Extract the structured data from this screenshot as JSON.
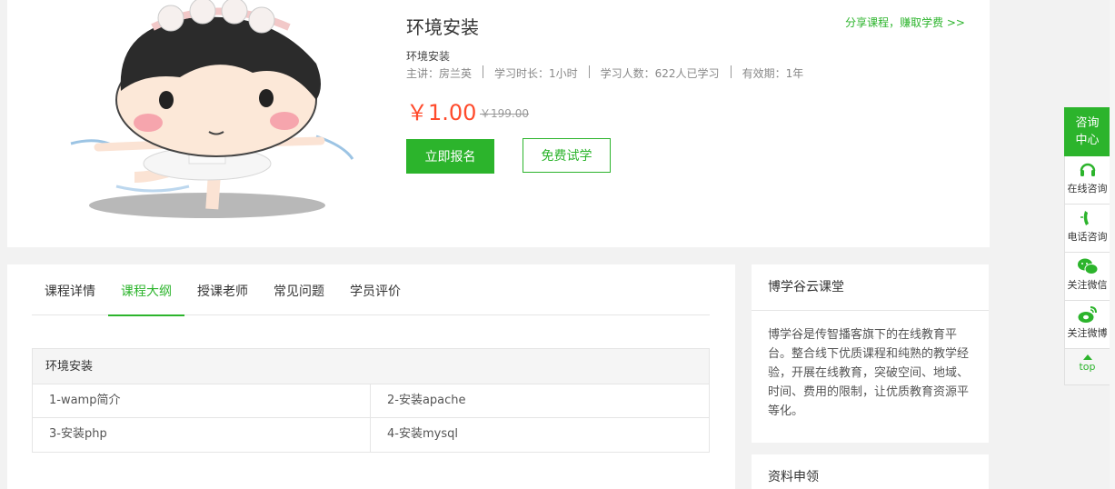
{
  "course": {
    "title": "环境安装",
    "share_link": "分享课程，赚取学费 >>",
    "subtitle": "环境安装",
    "meta": [
      "主讲：房兰英",
      "学习时长：1小时",
      "学习人数：622人已学习",
      "有效期：1年"
    ],
    "price": "￥1.00",
    "original_price": "￥199.00",
    "enroll_button": "立即报名",
    "trial_button": "免费试学"
  },
  "tabs": [
    {
      "label": "课程详情",
      "active": false
    },
    {
      "label": "课程大纲",
      "active": true
    },
    {
      "label": "授课老师",
      "active": false
    },
    {
      "label": "常见问题",
      "active": false
    },
    {
      "label": "学员评价",
      "active": false
    }
  ],
  "outline": {
    "section_title": "环境安装",
    "lessons": [
      "1-wamp简介",
      "2-安装apache",
      "3-安装php",
      "4-安装mysql"
    ]
  },
  "sidebar": {
    "about_title": "博学谷云课堂",
    "about_text": "博学谷是传智播客旗下的在线教育平台。整合线下优质课程和纯熟的教学经验，开展在线教育，突破空间、地域、时间、费用的限制，让优质教育资源平等化。",
    "materials_title": "资料申领"
  },
  "float_bar": {
    "header": "咨询中心",
    "items": [
      {
        "label": "在线咨询",
        "icon": "headset-icon"
      },
      {
        "label": "电话咨询",
        "icon": "phone-icon"
      },
      {
        "label": "关注微信",
        "icon": "wechat-icon"
      },
      {
        "label": "关注微博",
        "icon": "weibo-icon"
      }
    ],
    "top_label": "top"
  },
  "colors": {
    "accent": "#2cb42c",
    "price": "#ff4a2b"
  }
}
